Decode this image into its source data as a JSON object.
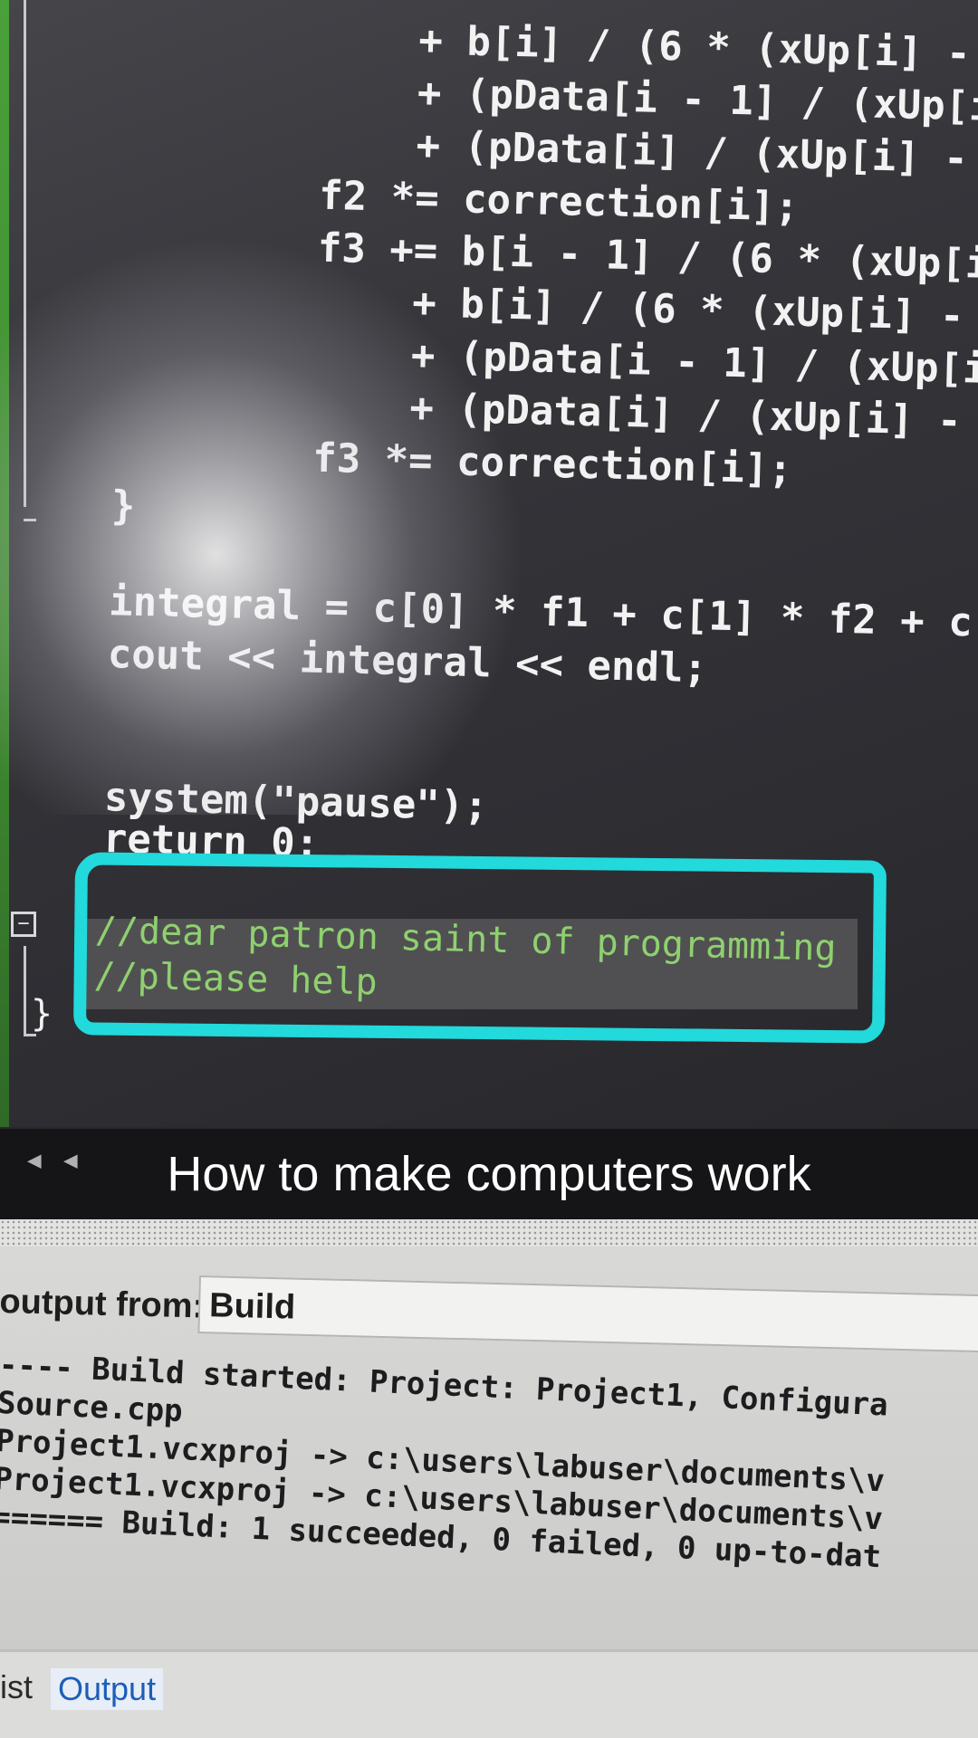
{
  "editor": {
    "code_lines": [
      "         + b[i] / (6 * (xUp[i] - xUp[i -",
      "         + (pData[i - 1] / (xUp[i] - xUp",
      "         + (pData[i] / (xUp[i] - xUp[i -",
      "     f2 *= correction[i];",
      "     f3 += b[i - 1] / (6 * (xUp[i] - xUp",
      "         + b[i] / (6 * (xUp[i] - xUp[i -",
      "         + (pData[i - 1] / (xUp[i] - xUp[",
      "         + (pData[i] / (xUp[i] - xUp[i -",
      "     f3 *= correction[i];",
      " }",
      "",
      " integral = c[0] * f1 + c[1] * f2 + c[2]",
      " cout << integral << endl;",
      "",
      "",
      " system(\"pause\");",
      " return 0;"
    ],
    "comments": [
      "//dear patron saint of programming",
      "//please help"
    ],
    "closing_brace": "}",
    "collapse_glyph": "−",
    "highlight_color": "#22d9dc"
  },
  "caption": {
    "text": "How to make computers work"
  },
  "output": {
    "from_label": "output from:",
    "source_value": "Build",
    "lines": [
      "---- Build started: Project: Project1, Configura",
      "Source.cpp",
      "Project1.vcxproj -> c:\\users\\labuser\\documents\\v",
      "Project1.vcxproj -> c:\\users\\labuser\\documents\\v",
      "====== Build: 1 succeeded, 0 failed, 0 up-to-dat"
    ],
    "tabs": {
      "list": "ist",
      "output": "Output"
    }
  },
  "colors": {
    "accent": "#22d9dc",
    "comment": "#8fd06f",
    "active_tab": "#1c5fb8"
  }
}
